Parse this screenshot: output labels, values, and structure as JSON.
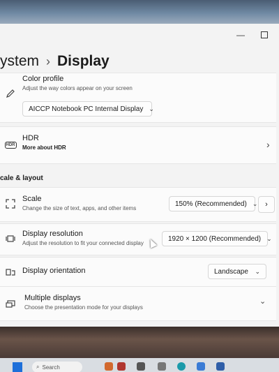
{
  "breadcrumb": {
    "parent": "ystem",
    "separator": "›",
    "current": "Display"
  },
  "window": {
    "minimize_glyph": "—"
  },
  "color_profile": {
    "title": "Color profile",
    "subtitle": "Adjust the way colors appear on your screen",
    "selected": "AICCP Notebook PC Internal Display",
    "icon": "pen-icon"
  },
  "hdr": {
    "title": "HDR",
    "subtitle": "More about HDR",
    "badge": "HDR"
  },
  "section": {
    "title": "cale & layout"
  },
  "scale": {
    "title": "Scale",
    "subtitle": "Change the size of text, apps, and other items",
    "selected": "150% (Recommended)"
  },
  "resolution": {
    "title": "Display resolution",
    "subtitle": "Adjust the resolution to fit your connected display",
    "selected": "1920 × 1200 (Recommended)"
  },
  "orientation": {
    "title": "Display orientation",
    "selected": "Landscape"
  },
  "multiple": {
    "title": "Multiple displays",
    "subtitle": "Choose the presentation mode for your displays"
  },
  "taskbar": {
    "search_text": "Search"
  },
  "colors": {
    "background": "#f3f3f3",
    "card": "#fbfbfb",
    "start_blue": "#1e6fd9"
  }
}
